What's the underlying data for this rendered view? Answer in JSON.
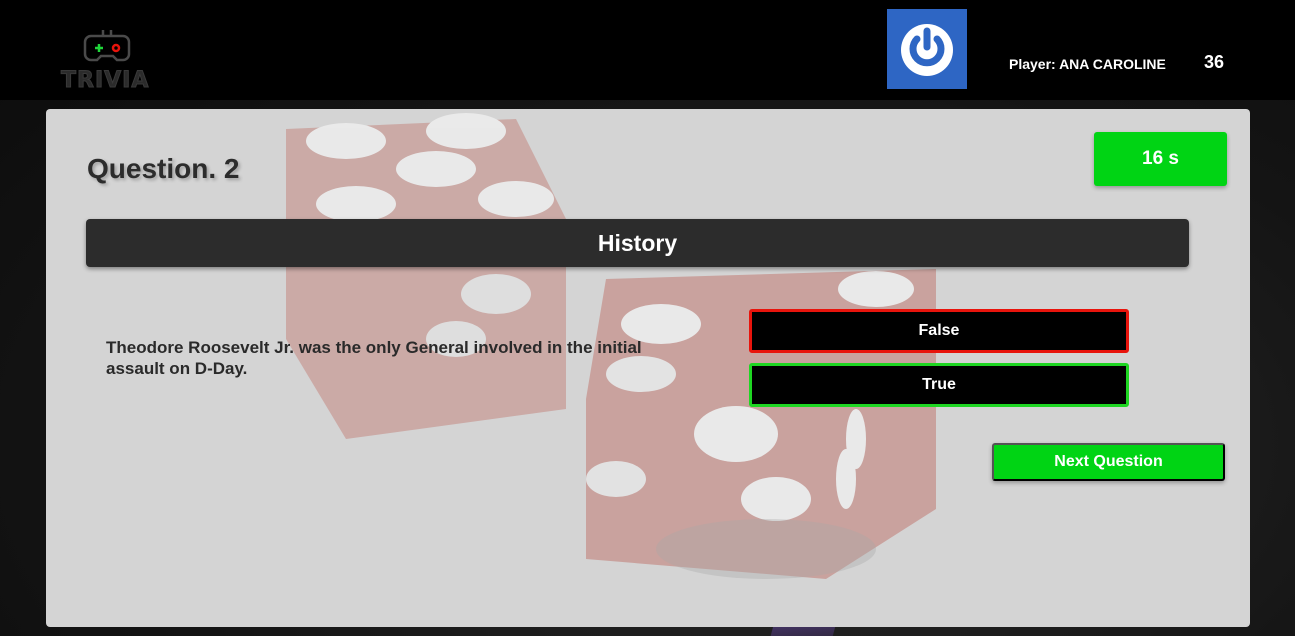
{
  "header": {
    "logo_text": "TRIVIA",
    "player_label": "Player: ANA CAROLINE",
    "score": "36",
    "avatar_icon": "power-icon",
    "avatar_color": "#2e66c4"
  },
  "game": {
    "question_title": "Question. 2",
    "timer": "16 s",
    "category": "History",
    "question": "Theodore Roosevelt Jr. was the only General involved in the initial assault on D-Day.",
    "answers": [
      {
        "label": "False",
        "state": "wrong",
        "border_color": "#e8140c"
      },
      {
        "label": "True",
        "state": "correct",
        "border_color": "#1ed622"
      }
    ],
    "next_label": "Next Question"
  },
  "colors": {
    "accent_green": "#00d414",
    "card_bg": "#d4d4d4",
    "category_bg": "#2c2c2c"
  }
}
